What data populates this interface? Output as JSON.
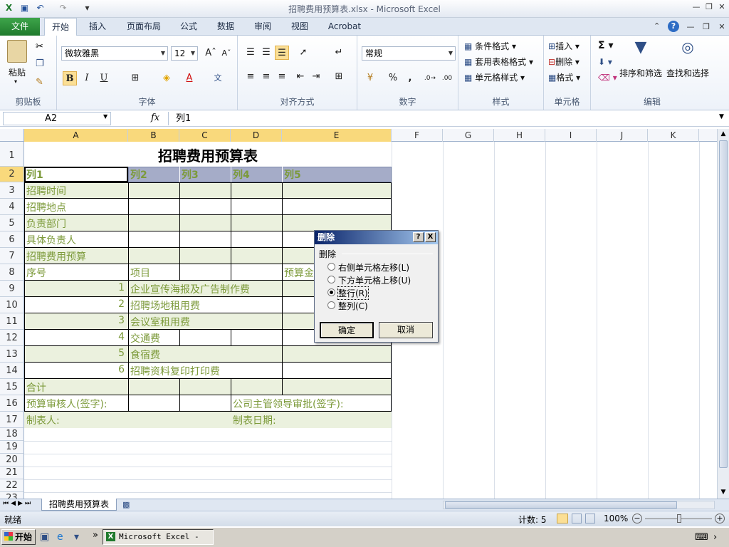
{
  "window": {
    "title": "招聘费用预算表.xlsx - Microsoft Excel"
  },
  "ribbon": {
    "tabs": [
      "文件",
      "开始",
      "插入",
      "页面布局",
      "公式",
      "数据",
      "审阅",
      "视图",
      "Acrobat"
    ],
    "clipboard": {
      "paste": "粘贴",
      "label": "剪贴板"
    },
    "font": {
      "name": "微软雅黑",
      "size": "12",
      "label": "字体",
      "bold": "B",
      "italic": "I",
      "underline": "U"
    },
    "alignment": {
      "label": "对齐方式"
    },
    "number": {
      "format": "常规",
      "label": "数字",
      "percent": "%",
      "comma": ","
    },
    "styles": {
      "conditional": "条件格式",
      "table": "套用表格格式",
      "cell": "单元格样式",
      "label": "样式"
    },
    "cells": {
      "insert": "插入",
      "delete": "删除",
      "format": "格式",
      "label": "单元格"
    },
    "editing": {
      "sort": "排序和筛选",
      "find": "查找和选择",
      "label": "编辑",
      "sigma": "Σ"
    }
  },
  "formula_bar": {
    "name_box": "A2",
    "fx": "fx",
    "content": "列1"
  },
  "columns": [
    "A",
    "B",
    "C",
    "D",
    "E",
    "F",
    "G",
    "H",
    "I",
    "J",
    "K"
  ],
  "rows": [
    "1",
    "2",
    "3",
    "4",
    "5",
    "6",
    "7",
    "8",
    "9",
    "10",
    "11",
    "12",
    "13",
    "14",
    "15",
    "16",
    "17",
    "18",
    "19",
    "20",
    "21",
    "22",
    "23"
  ],
  "sheet": {
    "title": "招聘费用预算表",
    "header": [
      "列1",
      "列2",
      "列3",
      "列4",
      "列5"
    ],
    "labels": {
      "r3": "招聘时间",
      "r4": "招聘地点",
      "r5": "负责部门",
      "r6": "具体负责人",
      "r7": "招聘费用预算",
      "r8a": "序号",
      "r8b": "项目",
      "r8e": "预算金",
      "r15": "合计",
      "r16a": "预算审核人(签字):",
      "r16d": "公司主管领导审批(签字):",
      "r17a": "制表人:",
      "r17d": "制表日期:"
    },
    "items": [
      {
        "no": "1",
        "name": "企业宣传海报及广告制作费"
      },
      {
        "no": "2",
        "name": "招聘场地租用费"
      },
      {
        "no": "3",
        "name": "会议室租用费"
      },
      {
        "no": "4",
        "name": "交通费"
      },
      {
        "no": "5",
        "name": "食宿费"
      },
      {
        "no": "6",
        "name": "招聘资料复印打印费"
      }
    ]
  },
  "dialog": {
    "title": "删除",
    "help": "?",
    "close": "X",
    "group": "删除",
    "options": [
      "右侧单元格左移(L)",
      "下方单元格上移(U)",
      "整行(R)",
      "整列(C)"
    ],
    "selected": "整行(R)",
    "ok": "确定",
    "cancel": "取消"
  },
  "sheet_tab": "招聘费用预算表",
  "status": {
    "ready": "就绪",
    "count": "计数: 5",
    "zoom": "100%"
  },
  "taskbar": {
    "start": "开始",
    "task": "Microsoft Excel - ..."
  }
}
